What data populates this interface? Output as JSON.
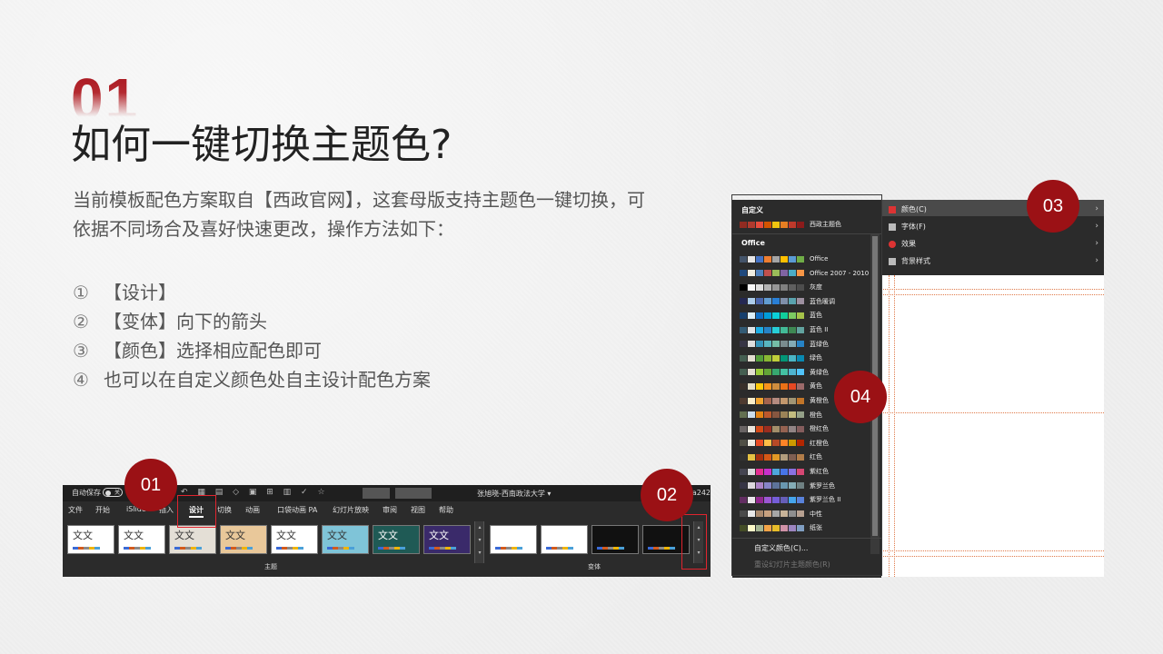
{
  "slide": {
    "number": "01",
    "title": "如何一键切换主题色?",
    "description": "当前模板配色方案取自【西政官网】，这套母版支持主题色一键切换，可依据不同场合及喜好快速更改，操作方法如下：",
    "steps": [
      {
        "num": "①",
        "text": "【设计】"
      },
      {
        "num": "②",
        "text": "【变体】向下的箭头"
      },
      {
        "num": "③",
        "text": "【颜色】选择相应配色即可"
      },
      {
        "num": "④",
        "text": "也可以在自定义颜色处自主设计配色方案"
      }
    ]
  },
  "ribbon": {
    "autosave": "自动保存",
    "toggle": "关",
    "user": "张旭晓-西南政法大学 ▾",
    "code": "a242",
    "tabs": [
      "文件",
      "开始",
      "iSlide",
      "插入",
      "设计",
      "切换",
      "动画",
      "口袋动画 PA",
      "幻灯片放映",
      "审阅",
      "视图",
      "帮助"
    ],
    "theme_thumb_text": "文文",
    "group_theme": "主题",
    "group_variant": "变体"
  },
  "callouts": [
    "01",
    "02",
    "03",
    "04"
  ],
  "colors_panel": {
    "items": [
      {
        "label": "颜色(C)",
        "icon_color": "#d33"
      },
      {
        "label": "字体(F)",
        "icon_color": "#bbb"
      },
      {
        "label": "效果",
        "icon_color": "#d33"
      },
      {
        "label": "背景样式",
        "icon_color": "#bbb"
      }
    ]
  },
  "color_dropdown": {
    "custom_header": "自定义",
    "custom_item": "西政主题色",
    "office_header": "Office",
    "schemes": [
      {
        "name": "Office",
        "c": [
          "#44546a",
          "#e7e6e6",
          "#4472c4",
          "#ed7d31",
          "#a5a5a5",
          "#ffc000",
          "#5b9bd5",
          "#70ad47"
        ]
      },
      {
        "name": "Office 2007 - 2010",
        "c": [
          "#1f497d",
          "#eeece1",
          "#4f81bd",
          "#c0504d",
          "#9bbb59",
          "#8064a2",
          "#4bacc6",
          "#f79646"
        ]
      },
      {
        "name": "灰度",
        "c": [
          "#000000",
          "#f8f8f8",
          "#dddddd",
          "#b2b2b2",
          "#969696",
          "#808080",
          "#5f5f5f",
          "#4d4d4d"
        ]
      },
      {
        "name": "蓝色暖调",
        "c": [
          "#242852",
          "#acccea",
          "#4a66ac",
          "#629dd1",
          "#297fd5",
          "#7f8fa9",
          "#5aa2ae",
          "#9d90a0"
        ]
      },
      {
        "name": "蓝色",
        "c": [
          "#17406d",
          "#dbeff9",
          "#0f6fc6",
          "#009dd9",
          "#0bd0d9",
          "#10cf9b",
          "#7cca62",
          "#a5c249"
        ]
      },
      {
        "name": "蓝色 II",
        "c": [
          "#335b74",
          "#dfe3e5",
          "#1cade4",
          "#2683c6",
          "#27ced7",
          "#42ba97",
          "#3e8853",
          "#62a39f"
        ]
      },
      {
        "name": "蓝绿色",
        "c": [
          "#373545",
          "#dedede",
          "#3494ba",
          "#58b6c0",
          "#75bda7",
          "#7a8c8e",
          "#84acb6",
          "#2683c6"
        ]
      },
      {
        "name": "绿色",
        "c": [
          "#455f51",
          "#e3ded1",
          "#549e39",
          "#8ab833",
          "#c0cf3a",
          "#029676",
          "#4ab5c4",
          "#0989b1"
        ]
      },
      {
        "name": "黄绿色",
        "c": [
          "#455f51",
          "#e3ded1",
          "#99cb38",
          "#63a537",
          "#37a76f",
          "#44c1a3",
          "#4eb3cf",
          "#51c3f9"
        ]
      },
      {
        "name": "黄色",
        "c": [
          "#39302a",
          "#e5dec5",
          "#ffca08",
          "#f8931d",
          "#ce8d3e",
          "#ec7016",
          "#e64823",
          "#9c6a6a"
        ]
      },
      {
        "name": "黄橙色",
        "c": [
          "#4e3b30",
          "#fbeec9",
          "#f0a22e",
          "#a5644e",
          "#b58b80",
          "#c3986d",
          "#a19574",
          "#c17529"
        ]
      },
      {
        "name": "橙色",
        "c": [
          "#637052",
          "#ccddea",
          "#e48312",
          "#bd582c",
          "#865640",
          "#9b8357",
          "#c2bc80",
          "#94a088"
        ]
      },
      {
        "name": "橙红色",
        "c": [
          "#696464",
          "#e9e5dc",
          "#d34817",
          "#9b2d1f",
          "#a28e6a",
          "#956251",
          "#918485",
          "#855d5d"
        ]
      },
      {
        "name": "红橙色",
        "c": [
          "#505046",
          "#eeece1",
          "#e84c22",
          "#ffbd47",
          "#b64926",
          "#ff8427",
          "#cc9900",
          "#b22600"
        ]
      },
      {
        "name": "红色",
        "c": [
          "#323232",
          "#e5c243",
          "#a5300f",
          "#d55816",
          "#e19825",
          "#b19c7d",
          "#7f5f52",
          "#b27d49"
        ]
      },
      {
        "name": "紫红色",
        "c": [
          "#454551",
          "#d8d9dc",
          "#e32d91",
          "#c830cc",
          "#4ea6dc",
          "#4775e7",
          "#8971e1",
          "#d54773"
        ]
      },
      {
        "name": "紫罗兰色",
        "c": [
          "#373545",
          "#dcd8dc",
          "#ad84c6",
          "#8784c7",
          "#5d739a",
          "#6997af",
          "#84acb6",
          "#6f8183"
        ]
      },
      {
        "name": "紫罗兰色 II",
        "c": [
          "#632e62",
          "#eae5eb",
          "#92278f",
          "#9b57d3",
          "#755dd9",
          "#665eb8",
          "#45a5ed",
          "#5982db"
        ]
      },
      {
        "name": "中性",
        "c": [
          "#4a4a4a",
          "#e8e8e8",
          "#aa8a6e",
          "#c8a17f",
          "#a6a6a6",
          "#c8b398",
          "#8e8e8e",
          "#b7a191"
        ]
      },
      {
        "name": "纸张",
        "c": [
          "#444d26",
          "#fefac9",
          "#a5b592",
          "#f3a447",
          "#e7bc29",
          "#d092a7",
          "#9c85c0",
          "#809ec2"
        ]
      }
    ],
    "custom_colors": "自定义颜色(C)...",
    "reset": "重设幻灯片主题颜色(R)",
    "custom_swatch": [
      "#8b1b1b",
      "#c0392b",
      "#e67e22",
      "#f1c40f",
      "#d35400",
      "#e74c3c",
      "#b03a2e",
      "#922b21"
    ]
  }
}
